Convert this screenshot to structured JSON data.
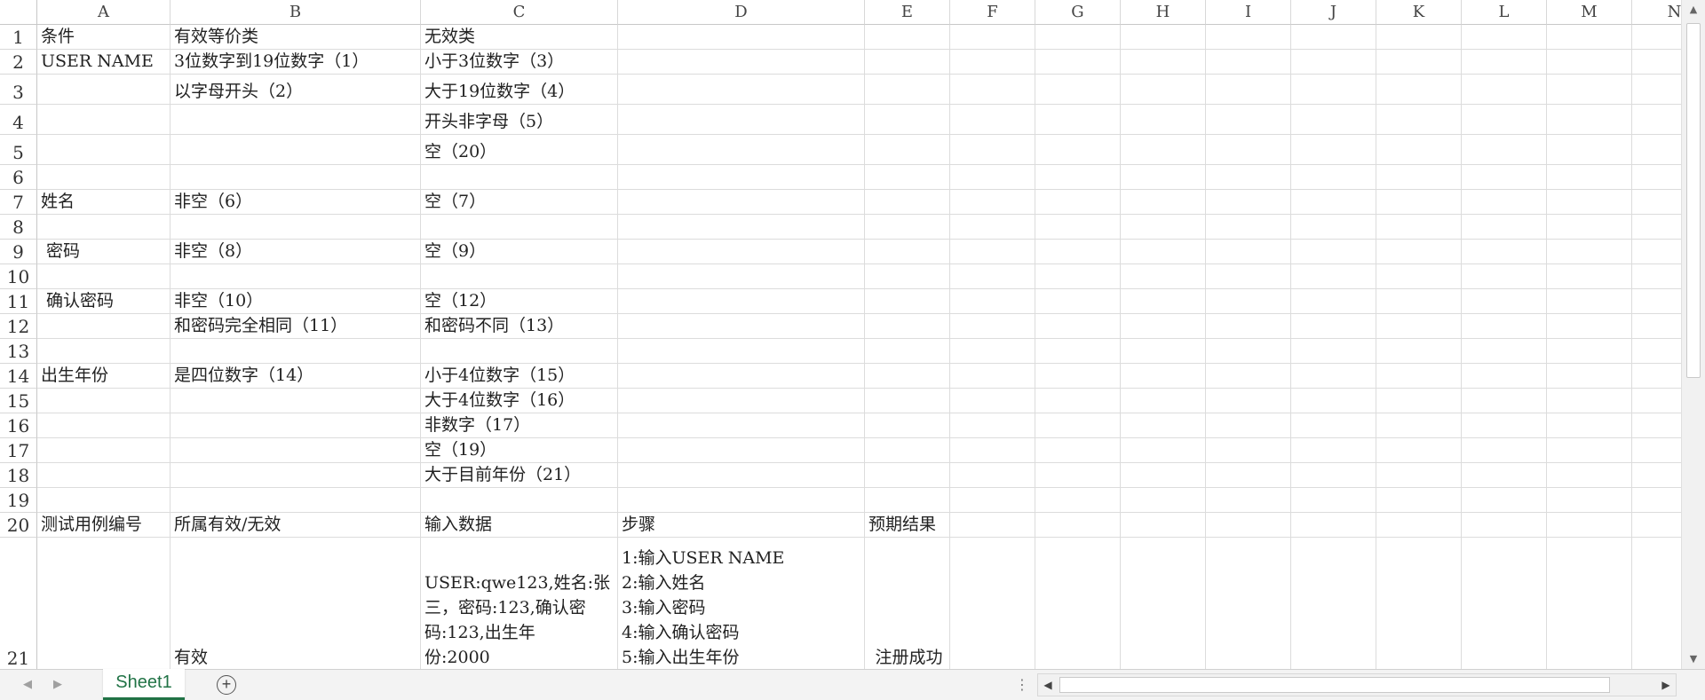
{
  "columns": [
    "A",
    "B",
    "C",
    "D",
    "E",
    "F",
    "G",
    "H",
    "I",
    "J",
    "K",
    "L",
    "M",
    "N"
  ],
  "rows": [
    "1",
    "2",
    "3",
    "4",
    "5",
    "6",
    "7",
    "8",
    "9",
    "10",
    "11",
    "12",
    "13",
    "14",
    "15",
    "16",
    "17",
    "18",
    "19",
    "20",
    "21"
  ],
  "cells": {
    "A1": "条件",
    "B1": "有效等价类",
    "C1": "无效类",
    "A2": "USER NAME",
    "B2": "3位数字到19位数字（1）",
    "C2": "小于3位数字（3）",
    "B3": "以字母开头（2）",
    "C3": "大于19位数字（4）",
    "C4": "开头非字母（5）",
    "C5": "空（20）",
    "A7": "姓名",
    "B7": "非空（6）",
    "C7": "空（7）",
    "A9": " 密码",
    "B9": "非空（8）",
    "C9": "空（9）",
    "A11": " 确认密码",
    "B11": "非空（10）",
    "C11": "空（12）",
    "B12": "和密码完全相同（11）",
    "C12": "和密码不同（13）",
    "A14": "出生年份",
    "B14": "是四位数字（14）",
    "C14": "小于4位数字（15）",
    "C15": "大于4位数字（16）",
    "C16": "非数字（17）",
    "C17": "空（19）",
    "C18": "大于目前年份（21）",
    "A20": "测试用例编号",
    "B20": "所属有效/无效",
    "C20": "输入数据",
    "D20": "步骤",
    "E20": "预期结果",
    "B21": "有效",
    "C21": "USER:qwe123,姓名:张\n三，密码:123,确认密\n码:123,出生年\n份:2000",
    "D21": "1:输入USER NAME\n2:输入姓名\n3:输入密码\n4:输入确认密码\n5:输入出生年份",
    "E21": "注册成功"
  },
  "sheet_tab": "Sheet1",
  "add_sheet_symbol": "+",
  "dots_symbol": "⋮",
  "colors": {
    "accent": "#217346",
    "gridline": "#dcdcdc",
    "bar_background": "#f3f3f3"
  }
}
